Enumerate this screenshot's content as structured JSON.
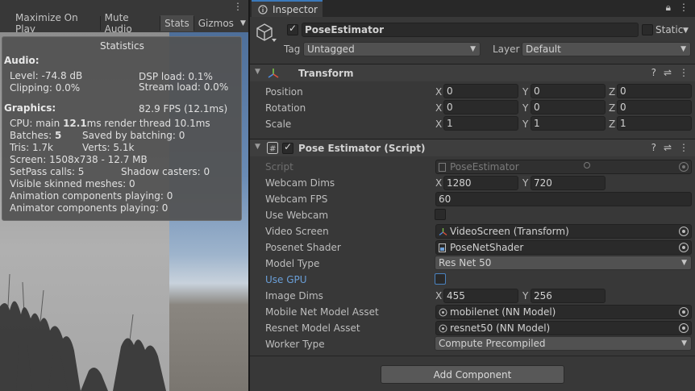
{
  "game_toolbar": {
    "buttons": [
      {
        "label": "Maximize On Play",
        "active": false
      },
      {
        "label": "Mute Audio",
        "active": false
      },
      {
        "label": "Stats",
        "active": true
      },
      {
        "label": "Gizmos",
        "active": false
      }
    ],
    "menu_icon": "kebab-menu-icon"
  },
  "stats": {
    "title": "Statistics",
    "audio_header": "Audio:",
    "level": "Level: -74.8 dB",
    "dsp": "DSP load: 0.1%",
    "clipping": "Clipping: 0.0%",
    "stream": "Stream load: 0.0%",
    "graphics_header": "Graphics:",
    "fps": "82.9 FPS (12.1ms)",
    "cpu_prefix": "CPU: main ",
    "cpu_main": "12.1",
    "cpu_suffix": "ms  render thread 10.1ms",
    "batches_prefix": "Batches: ",
    "batches": "5",
    "saved": "Saved by batching: 0",
    "tris": "Tris: 1.7k",
    "verts": "Verts: 5.1k",
    "screen": "Screen: 1508x738 - 12.7 MB",
    "setpass": "SetPass calls: 5",
    "shadow": "Shadow casters: 0",
    "skinned": "Visible skinned meshes: 0",
    "anim": "Animation components playing: 0",
    "animator": "Animator components playing: 0"
  },
  "inspector": {
    "tab_label": "Inspector",
    "object_name": "PoseEstimator",
    "static_label": "Static",
    "tag_label": "Tag",
    "tag_value": "Untagged",
    "layer_label": "Layer",
    "layer_value": "Default",
    "transform": {
      "title": "Transform",
      "rows": [
        {
          "label": "Position",
          "x": "0",
          "y": "0",
          "z": "0"
        },
        {
          "label": "Rotation",
          "x": "0",
          "y": "0",
          "z": "0"
        },
        {
          "label": "Scale",
          "x": "1",
          "y": "1",
          "z": "1"
        }
      ]
    },
    "script_comp": {
      "title": "Pose Estimator (Script)",
      "script_label": "Script",
      "script_value": "PoseEstimator",
      "webcam_dims_label": "Webcam Dims",
      "webcam_dims_x": "1280",
      "webcam_dims_y": "720",
      "webcam_fps_label": "Webcam FPS",
      "webcam_fps": "60",
      "use_webcam_label": "Use Webcam",
      "use_webcam": false,
      "video_screen_label": "Video Screen",
      "video_screen": "VideoScreen (Transform)",
      "posenet_shader_label": "Posenet Shader",
      "posenet_shader": "PoseNetShader",
      "model_type_label": "Model Type",
      "model_type": "Res Net 50",
      "use_gpu_label": "Use GPU",
      "use_gpu": false,
      "image_dims_label": "Image Dims",
      "image_dims_x": "455",
      "image_dims_y": "256",
      "mobile_asset_label": "Mobile Net Model Asset",
      "mobile_asset": "mobilenet (NN Model)",
      "resnet_asset_label": "Resnet Model Asset",
      "resnet_asset": "resnet50 (NN Model)",
      "worker_type_label": "Worker Type",
      "worker_type": "Compute Precompiled"
    },
    "add_component": "Add Component",
    "axis_x": "X",
    "axis_y": "Y",
    "axis_z": "Z"
  },
  "colors": {
    "accent": "#3a79bb",
    "panel": "#383838",
    "field": "#2a2a2a",
    "use_gpu_label": "#6a9fd8"
  }
}
